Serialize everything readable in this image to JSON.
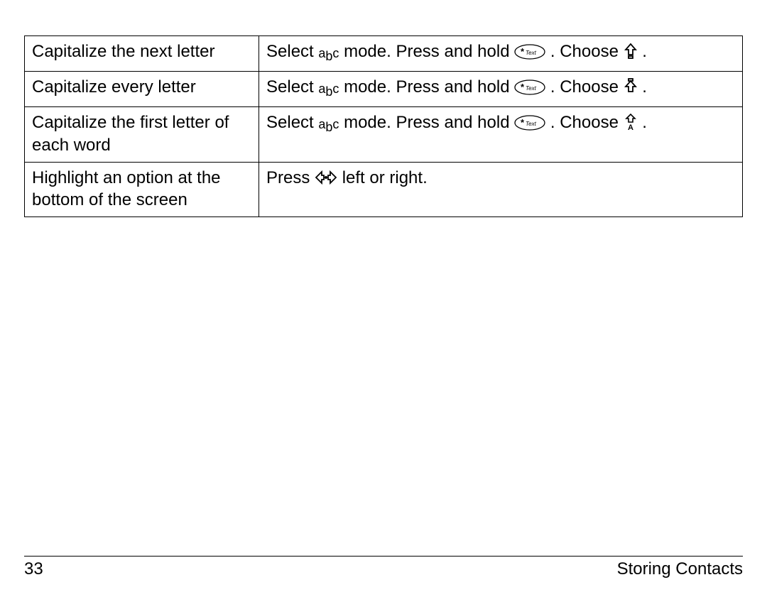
{
  "table": {
    "rows": [
      {
        "action": "Capitalize the next letter",
        "instr": {
          "select": "Select",
          "mode_label": "abc",
          "mode_text": " mode. Press and hold ",
          "key_label": "*Text",
          "choose": ". Choose ",
          "cap_icon": "cap-next",
          "end": "."
        }
      },
      {
        "action": "Capitalize every letter",
        "instr": {
          "select": "Select",
          "mode_label": "abc",
          "mode_text": " mode. Press and hold ",
          "key_label": "*Text",
          "choose": ". Choose ",
          "cap_icon": "cap-all",
          "end": "."
        }
      },
      {
        "action": "Capitalize the first letter of each word",
        "instr": {
          "select": "Select",
          "mode_label": "abc",
          "mode_text": " mode. Press and hold ",
          "key_label": "*Text",
          "choose": ". Choose ",
          "cap_icon": "cap-word",
          "end": "."
        }
      },
      {
        "action": "Highlight an option at the bottom of the screen",
        "instr_plain": {
          "press": "Press ",
          "nav_icon": "nav",
          "tail": " left or right."
        }
      }
    ]
  },
  "footer": {
    "page_number": "33",
    "section": "Storing Contacts"
  }
}
